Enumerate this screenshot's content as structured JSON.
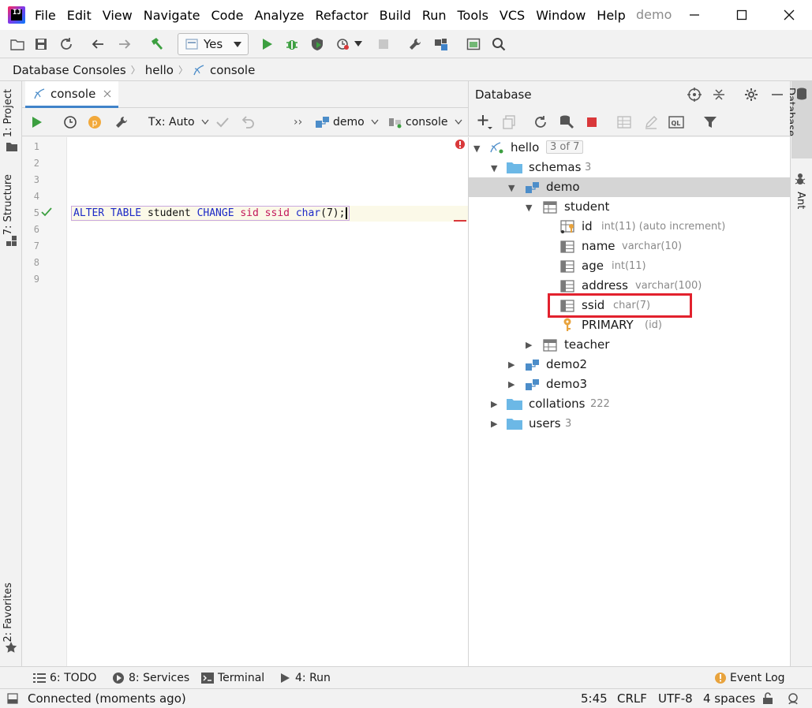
{
  "menu": {
    "items": [
      "File",
      "Edit",
      "View",
      "Navigate",
      "Code",
      "Analyze",
      "Refactor",
      "Build",
      "Run",
      "Tools",
      "VCS",
      "Window",
      "Help"
    ],
    "window_title": "demo",
    "logo_text": "IJ"
  },
  "toolbar": {
    "run_config": "Yes"
  },
  "breadcrumb": {
    "items": [
      "Database Consoles",
      "hello",
      "console"
    ]
  },
  "left_strip": {
    "project": "1: Project",
    "structure": "7: Structure",
    "favorites": "2: Favorites"
  },
  "right_strip": {
    "database": "Database",
    "ant": "Ant"
  },
  "editor": {
    "tab_label": "console",
    "tx_label": "Tx: Auto",
    "schema_label": "demo",
    "session_label": "console",
    "line_numbers": [
      "1",
      "2",
      "3",
      "4",
      "5",
      "6",
      "7",
      "8",
      "9"
    ],
    "code_tokens": {
      "alter": "ALTER",
      "table": "TABLE",
      "student": "student",
      "change": "CHANGE",
      "sid": "sid",
      "ssid": "ssid",
      "char": "char",
      "args": "(7)",
      "end": ";"
    }
  },
  "database_panel": {
    "title": "Database",
    "tree": {
      "root": {
        "label": "hello",
        "counter": "3 of 7"
      },
      "schemas": {
        "label": "schemas",
        "count": "3"
      },
      "demo": {
        "label": "demo"
      },
      "student": {
        "label": "student"
      },
      "columns": [
        {
          "name": "id",
          "type": "int(11) (auto increment)"
        },
        {
          "name": "name",
          "type": "varchar(10)"
        },
        {
          "name": "age",
          "type": "int(11)"
        },
        {
          "name": "address",
          "type": "varchar(100)"
        },
        {
          "name": "ssid",
          "type": "char(7)"
        }
      ],
      "primary": {
        "name": "PRIMARY",
        "type": "(id)"
      },
      "teacher": {
        "label": "teacher"
      },
      "demo2": {
        "label": "demo2"
      },
      "demo3": {
        "label": "demo3"
      },
      "collations": {
        "label": "collations",
        "count": "222"
      },
      "users": {
        "label": "users",
        "count": "3"
      }
    },
    "highlight_color": "#e2212d"
  },
  "bottom_tools": {
    "todo": "6: TODO",
    "services": "8: Services",
    "terminal": "Terminal",
    "run": "4: Run",
    "event_log": "Event Log"
  },
  "status": {
    "message": "Connected (moments ago)",
    "position": "5:45",
    "line_sep": "CRLF",
    "encoding": "UTF-8",
    "indent": "4 spaces"
  },
  "colors": {
    "accent": "#4083c9",
    "run_green": "#3c9f40",
    "stop_red": "#d9383a",
    "folder_blue": "#6cb8e6"
  }
}
